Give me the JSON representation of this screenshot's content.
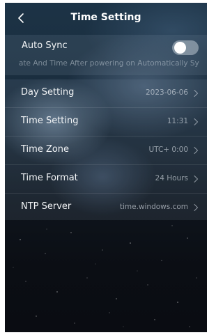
{
  "header": {
    "title": "Time Setting",
    "back_icon": "chevron-left-icon"
  },
  "auto_sync": {
    "label": "Auto Sync",
    "description": "ate And Time After powering on Automatically Sy",
    "toggle_on": false
  },
  "settings": [
    {
      "label": "Day Setting",
      "value": "2023-06-06"
    },
    {
      "label": "Time Setting",
      "value": "11:31"
    },
    {
      "label": "Time Zone",
      "value": "UTC+ 0:00"
    },
    {
      "label": "Time Format",
      "value": "24 Hours"
    },
    {
      "label": "NTP Server",
      "value": "time.windows.com"
    }
  ],
  "colors": {
    "text": "#f2f4f6",
    "secondary_text": "#cdd4dc",
    "background_top": "#1c3346",
    "background_bottom": "#0a0c12"
  }
}
